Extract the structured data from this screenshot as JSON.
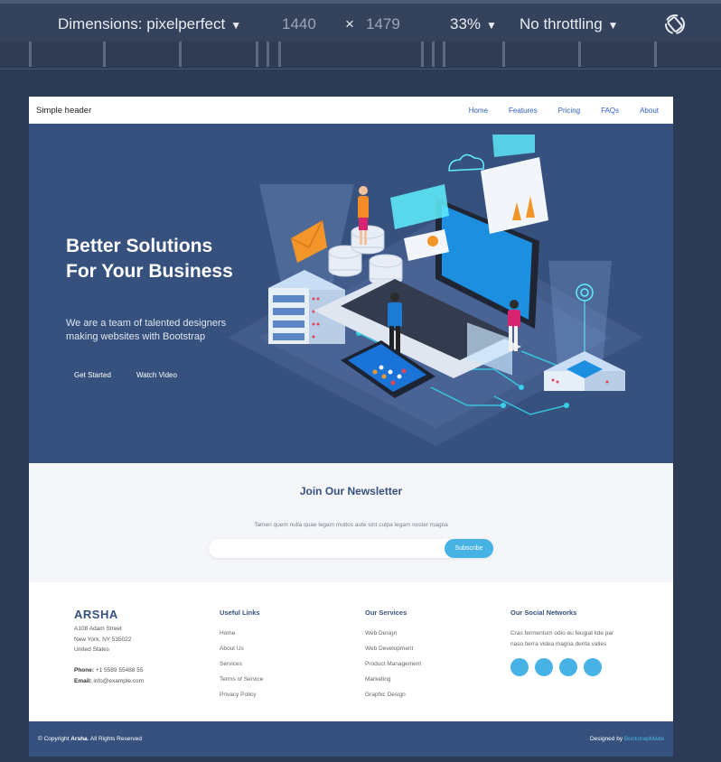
{
  "devtools": {
    "dimensions_label": "Dimensions: pixelperfect",
    "width": "1440",
    "times": "×",
    "height": "1479",
    "zoom": "33%",
    "throttling": "No throttling",
    "caret": "▼"
  },
  "header": {
    "brand": "Simple header",
    "nav": [
      "Home",
      "Features",
      "Pricing",
      "FAQs",
      "About"
    ]
  },
  "hero": {
    "title": "Better Solutions For Your Business",
    "subtitle": "We are a team of talented designers making websites with Bootstrap",
    "primary_button": "Get Started",
    "secondary_button": "Watch Video"
  },
  "newsletter": {
    "title": "Join Our Newsletter",
    "text": "Tamen quem nulla quae legam multos aute sint culpa legam noster magna",
    "input_value": "",
    "button": "Subscribe"
  },
  "footer": {
    "logo": "ARSHA",
    "address": [
      "A108 Adam Street",
      "New York, NY 535022",
      "United States"
    ],
    "phone_label": "Phone:",
    "phone": "+1 5589 55488 55",
    "email_label": "Email:",
    "email": "info@example.com",
    "useful_links_title": "Useful Links",
    "useful_links": [
      "Home",
      "About Us",
      "Services",
      "Terms of Service",
      "Privacy Policy"
    ],
    "services_title": "Our Services",
    "services": [
      "Web Design",
      "Web Development",
      "Product Management",
      "Marketing",
      "Graphic Design"
    ],
    "social_title": "Our Social Networks",
    "social_text": "Cras fermentum odio eu feugiat lide par naso tierra videa magna derita valies",
    "copyright_prefix": "© Copyright ",
    "copyright_brand": "Arsha",
    "copyright_suffix": ". All Rights Reserved",
    "designed_by": "Designed by ",
    "designer": "BootstrapMade"
  },
  "colors": {
    "accent": "#47b2e4",
    "brand": "#37517e"
  }
}
